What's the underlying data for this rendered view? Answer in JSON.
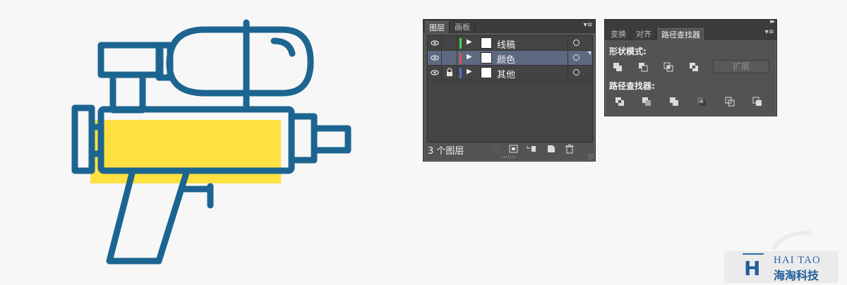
{
  "colors": {
    "canvas": "#f7f7f7",
    "artwork_stroke": "#1d6591",
    "artwork_fill": "#fee040",
    "panel_bg": "#535353",
    "selected_row": "#5d6980"
  },
  "layers_panel": {
    "tabs": [
      {
        "label": "图层",
        "active": true
      },
      {
        "label": "画板",
        "active": false
      }
    ],
    "menu_icon": "panel-menu-icon",
    "layers": [
      {
        "name": "线稿",
        "color": "#4cd64c",
        "visible": true,
        "locked": false,
        "selected": false
      },
      {
        "name": "颜色",
        "color": "#e05050",
        "visible": true,
        "locked": false,
        "selected": true
      },
      {
        "name": "其他",
        "color": "#4a6fd9",
        "visible": true,
        "locked": true,
        "selected": false
      }
    ],
    "layer_count": "3 个图层",
    "footer_icons": [
      "locate-object-icon",
      "make-clipping-mask-icon",
      "create-sublayer-icon",
      "create-new-layer-icon",
      "delete-layer-icon"
    ]
  },
  "pathfinder_panel": {
    "tabs": [
      {
        "label": "变换",
        "active": false
      },
      {
        "label": "对齐",
        "active": false
      },
      {
        "label": "路径查找器",
        "active": true
      }
    ],
    "shape_modes_label": "形状模式:",
    "shape_mode_icons": [
      "unite-icon",
      "minus-front-icon",
      "intersect-icon",
      "exclude-icon"
    ],
    "expand_label": "扩展",
    "pathfinders_label": "路径查找器:",
    "pathfinder_icons": [
      "divide-icon",
      "trim-icon",
      "merge-icon",
      "crop-icon",
      "outline-icon",
      "minus-back-icon"
    ]
  },
  "watermark": {
    "english": "HAI TAO",
    "chinese": "海淘科技",
    "mark": "H"
  }
}
